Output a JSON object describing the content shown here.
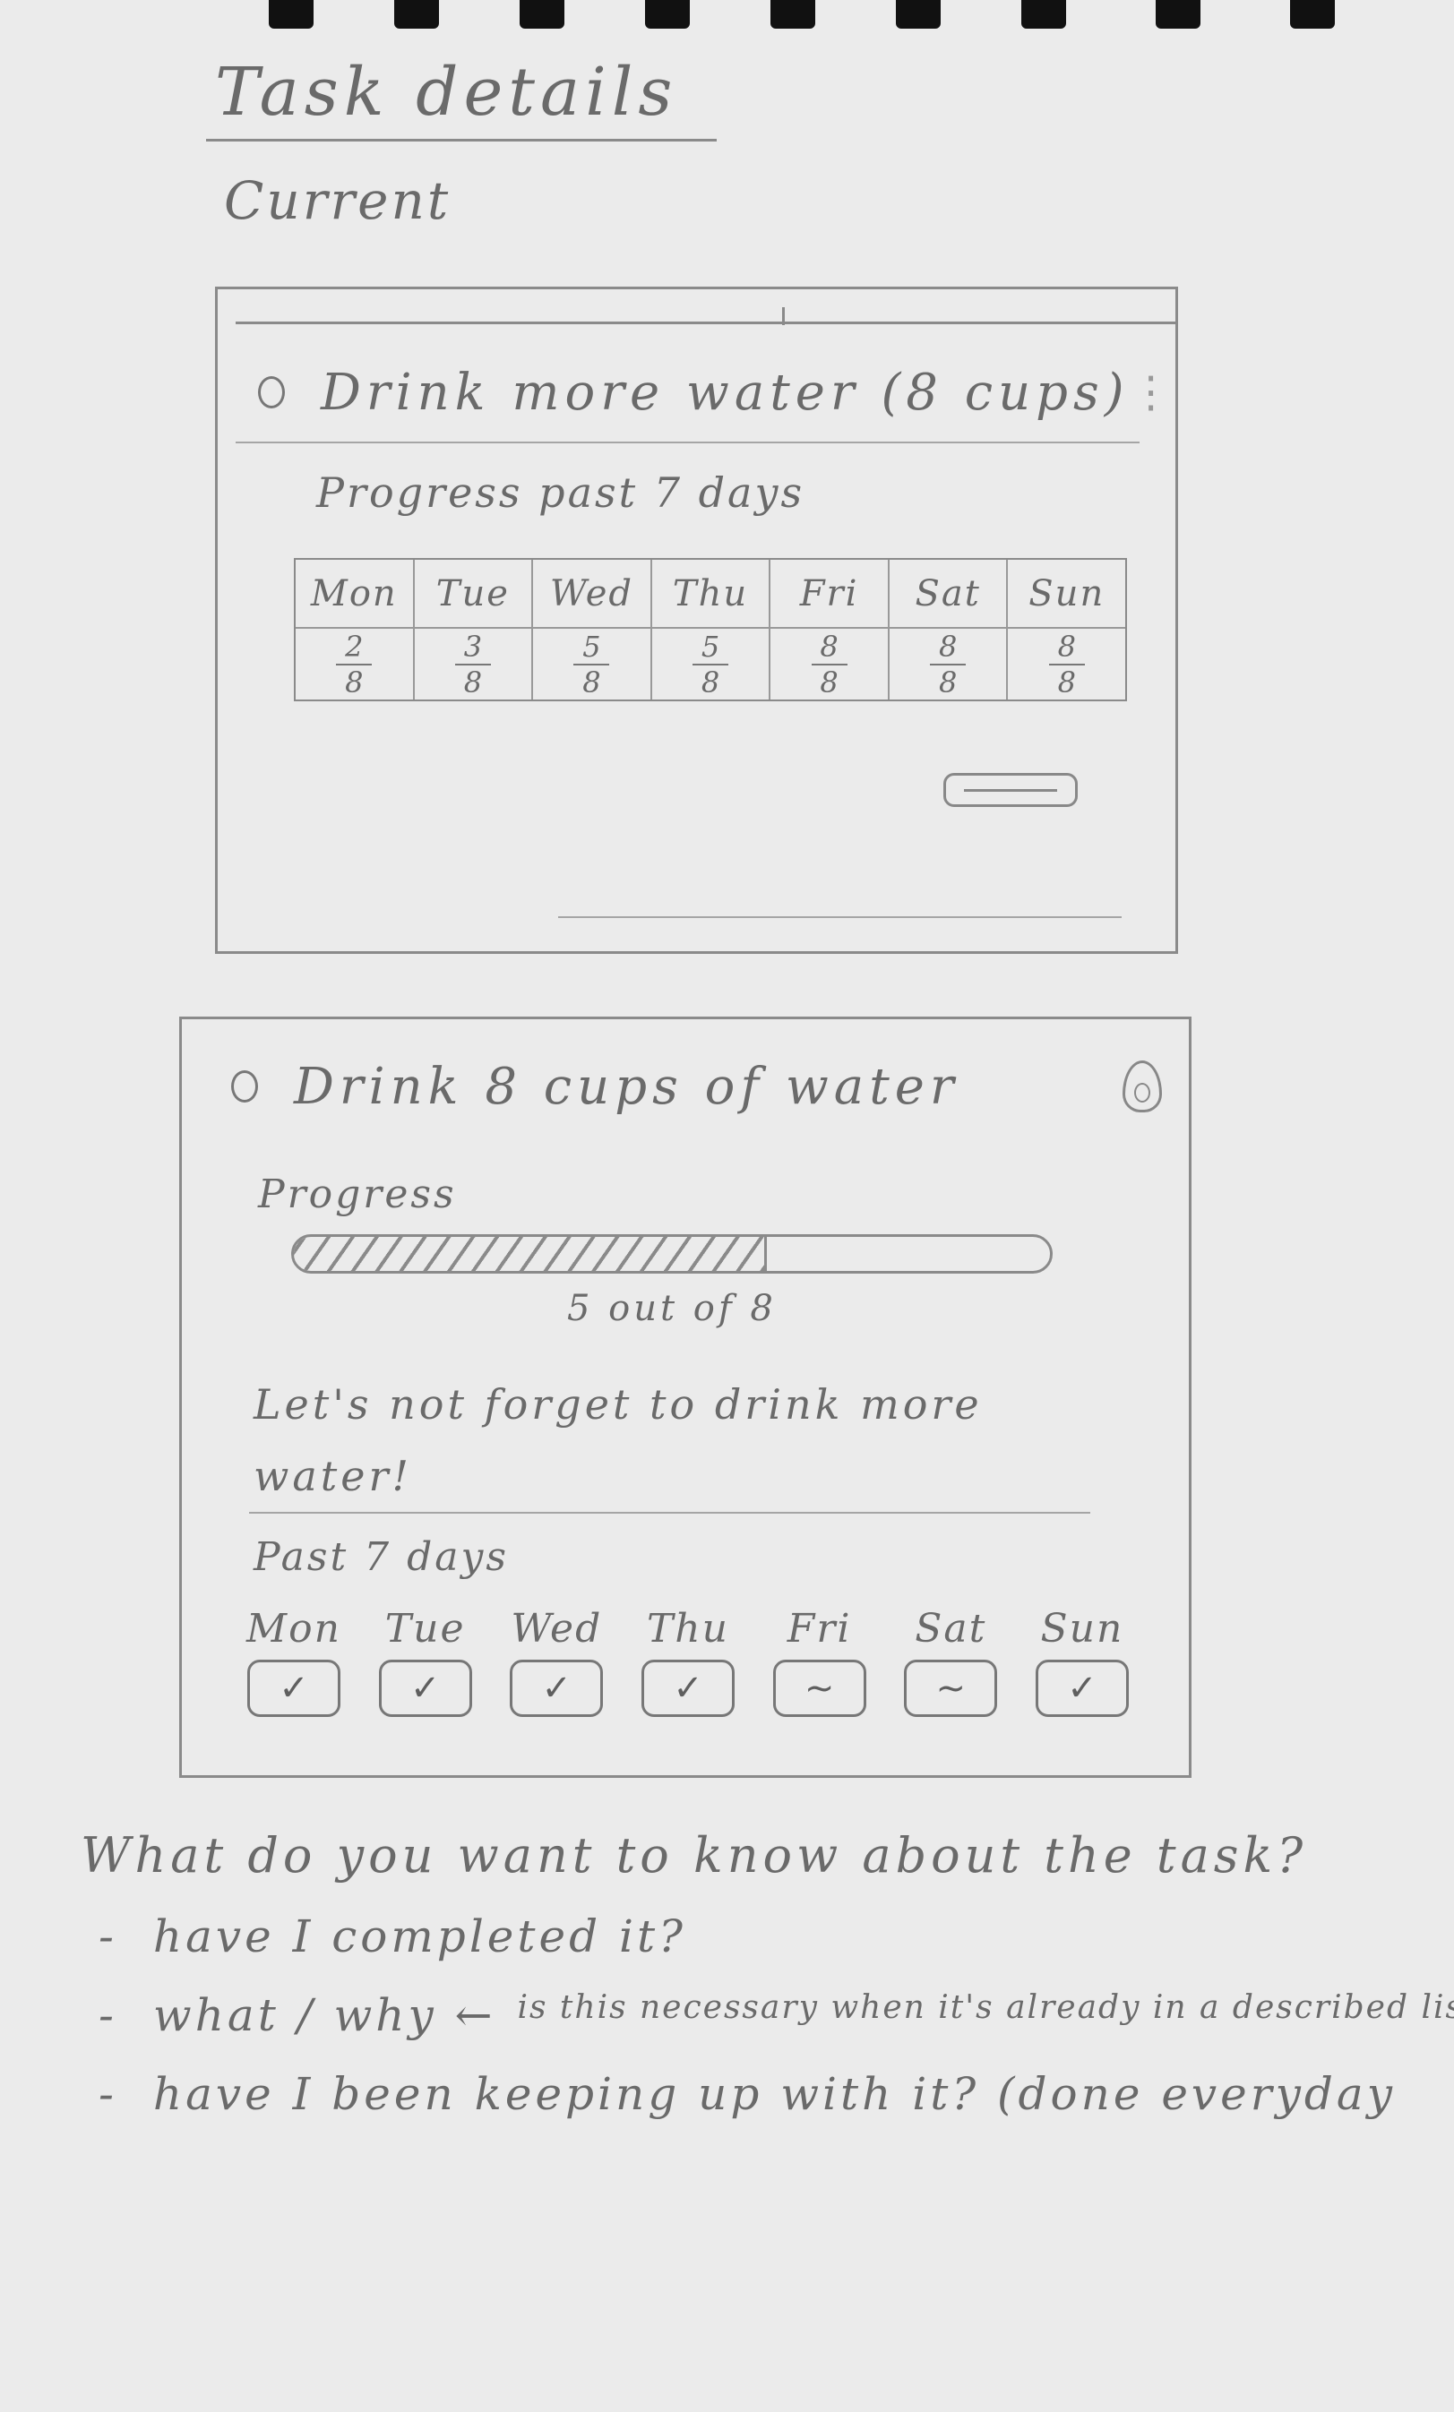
{
  "page": {
    "title": "Task details",
    "section_label": "Current"
  },
  "card_current": {
    "task_title": "Drink more water (8 cups)",
    "menu_icon": "kebab-menu-icon",
    "progress_label": "Progress past 7 days",
    "days": [
      {
        "name": "Mon",
        "done": "2",
        "goal": "8"
      },
      {
        "name": "Tue",
        "done": "3",
        "goal": "8"
      },
      {
        "name": "Wed",
        "done": "5",
        "goal": "8"
      },
      {
        "name": "Thu",
        "done": "5",
        "goal": "8"
      },
      {
        "name": "Fri",
        "done": "8",
        "goal": "8"
      },
      {
        "name": "Sat",
        "done": "8",
        "goal": "8"
      },
      {
        "name": "Sun",
        "done": "8",
        "goal": "8"
      }
    ]
  },
  "card_proposed": {
    "task_title": "Drink 8 cups of water",
    "badge_icon": "flame-icon",
    "progress_label": "Progress",
    "progress_value": 5,
    "progress_total": 8,
    "progress_text": "5 out of 8",
    "motto": "Let's not forget to drink more water!",
    "past_label": "Past 7 days",
    "days": [
      {
        "name": "Mon",
        "status": "✓"
      },
      {
        "name": "Tue",
        "status": "✓"
      },
      {
        "name": "Wed",
        "status": "✓"
      },
      {
        "name": "Thu",
        "status": "✓"
      },
      {
        "name": "Fri",
        "status": "~"
      },
      {
        "name": "Sat",
        "status": "~"
      },
      {
        "name": "Sun",
        "status": "✓"
      }
    ]
  },
  "notes": {
    "question": "What do you want to know about the task?",
    "items": [
      {
        "text": "have I completed it?",
        "aside": ""
      },
      {
        "text": "what / why ←",
        "aside": "is this necessary when it's already in a described list?"
      },
      {
        "text": "have I been keeping up with it? (done everyday",
        "aside": ""
      }
    ]
  }
}
